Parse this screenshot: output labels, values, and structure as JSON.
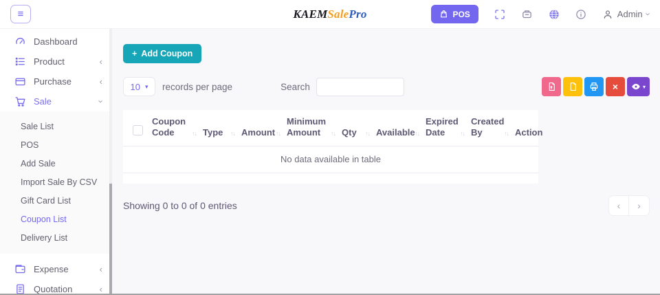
{
  "colors": {
    "accent_purple": "#7367f0",
    "teal_button": "#16a6b8",
    "pdf_button": "#f0688c",
    "excel_button": "#fdc00b",
    "print_button": "#2196f3",
    "close_button": "#e64c3c",
    "visibility_button": "#7a46cd",
    "logo_orange": "#f59d1f",
    "logo_blue": "#2b5bbd"
  },
  "header": {
    "menu_glyph": "≡",
    "logo_kaem": "KAEM",
    "logo_sale": "Sale",
    "logo_pro": "Pro",
    "pos_label": "POS",
    "admin_label": "Admin",
    "chevron_down": "›"
  },
  "sidebar": {
    "collapsed_chevron": "‹",
    "expanded_chevron": "›",
    "items": [
      {
        "label": "Dashboard"
      },
      {
        "label": "Product"
      },
      {
        "label": "Purchase"
      },
      {
        "label": "Sale"
      },
      {
        "label": "Expense"
      },
      {
        "label": "Quotation"
      }
    ],
    "sale_submenu": [
      {
        "label": "Sale List"
      },
      {
        "label": "POS"
      },
      {
        "label": "Add Sale"
      },
      {
        "label": "Import Sale By CSV"
      },
      {
        "label": "Gift Card List"
      },
      {
        "label": "Coupon List"
      },
      {
        "label": "Delivery List"
      }
    ]
  },
  "toolbar": {
    "add_icon": "+",
    "add_coupon_label": "Add Coupon"
  },
  "controls": {
    "page_size": "10",
    "select_caret": "▾",
    "records_label": "records per page",
    "search_label": "Search",
    "search_value": "",
    "close_glyph": "×",
    "eye_caret": "▾"
  },
  "table": {
    "sort_icon": "↑↓",
    "columns": [
      {
        "label": "Coupon Code"
      },
      {
        "label": "Type"
      },
      {
        "label": "Amount"
      },
      {
        "label": "Minimum Amount"
      },
      {
        "label": "Qty"
      },
      {
        "label": "Available"
      },
      {
        "label": "Expired Date"
      },
      {
        "label": "Created By"
      },
      {
        "label": "Action"
      }
    ],
    "empty_message": "No data available in table",
    "rows": []
  },
  "footer": {
    "showing_text": "Showing 0 to 0 of 0 entries",
    "prev_glyph": "‹",
    "next_glyph": "›"
  }
}
